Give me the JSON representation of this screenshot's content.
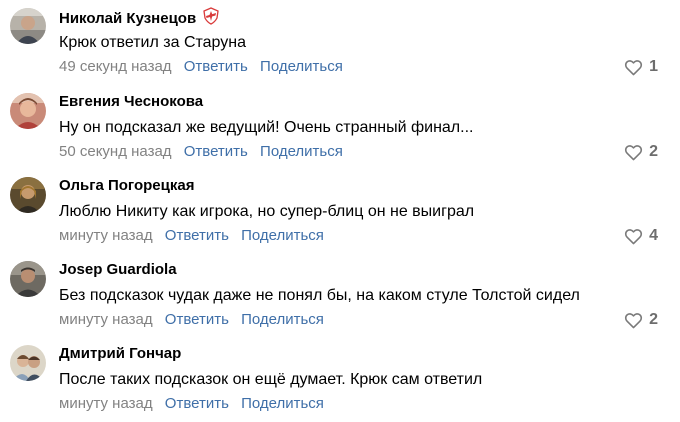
{
  "comments": [
    {
      "author": "Николай Кузнецов",
      "badge_icon": "spartak-club-badge-icon",
      "text": "Крюк ответил за Старуна",
      "time": "49 секунд назад",
      "reply_label": "Ответить",
      "share_label": "Поделиться",
      "likes": "1"
    },
    {
      "author": "Евгения Чеснокова",
      "text": "Ну он подсказал же ведущий! Очень странный финал...",
      "time": "50 секунд назад",
      "reply_label": "Ответить",
      "share_label": "Поделиться",
      "likes": "2"
    },
    {
      "author": "Ольга Погорецкая",
      "text": "Люблю Никиту как игрока, но супер-блиц он не выиграл",
      "time": "минуту назад",
      "reply_label": "Ответить",
      "share_label": "Поделиться",
      "likes": "4"
    },
    {
      "author": "Josep Guardiola",
      "text": "Без подсказок чудак даже не понял бы, на каком стуле Толстой сидел",
      "time": "минуту назад",
      "reply_label": "Ответить",
      "share_label": "Поделиться",
      "likes": "2"
    },
    {
      "author": "Дмитрий Гончар",
      "text": "После таких подсказок он ещё думает. Крюк сам ответил",
      "time": "минуту назад",
      "reply_label": "Ответить",
      "share_label": "Поделиться"
    }
  ],
  "icons": {
    "like": "heart-outline-icon",
    "badge": "spartak-club-badge-icon"
  },
  "colors": {
    "link": "#3f6fa8",
    "muted": "#828282",
    "like_count": "#6d6d6d",
    "badge_red": "#d93a3a"
  }
}
